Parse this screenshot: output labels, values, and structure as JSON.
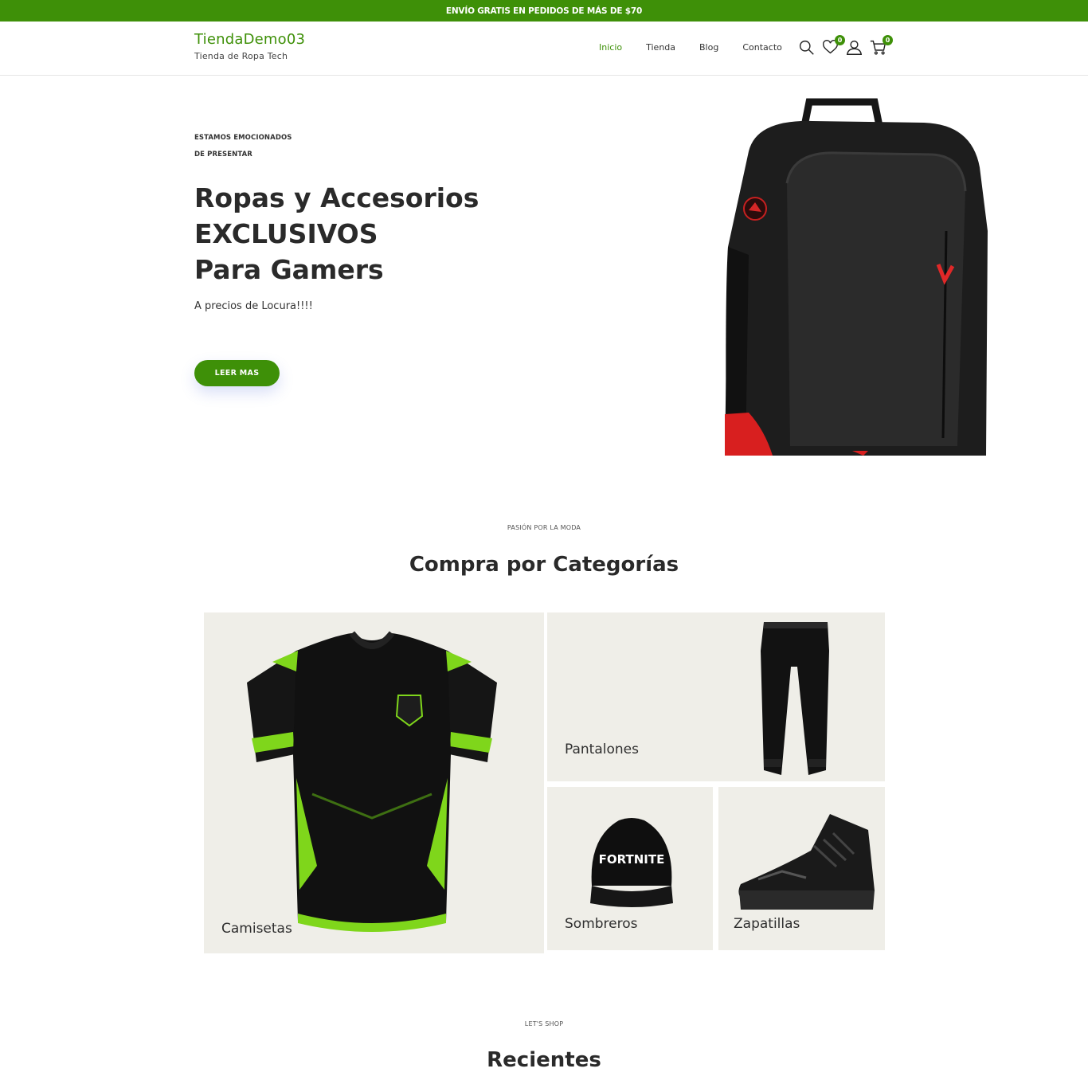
{
  "topbar": {
    "text": "ENVÍO GRATIS EN PEDIDOS DE MÁS DE $70"
  },
  "header": {
    "site_name": "TiendaDemo03",
    "tagline": "Tienda de Ropa Tech",
    "nav": [
      {
        "label": "Inicio",
        "active": true
      },
      {
        "label": "Tienda"
      },
      {
        "label": "Blog"
      },
      {
        "label": "Contacto"
      }
    ],
    "icons": [
      "search-icon",
      "heart-icon",
      "user-icon",
      "cart-icon"
    ],
    "wishlist_count": "0",
    "cart_count": "0"
  },
  "hero": {
    "eyebrow_line1": "ESTAMOS EMOCIONADOS",
    "eyebrow_line2": "DE PRESENTAR",
    "title_line1": "Ropas y Accesorios",
    "title_line2": "EXCLUSIVOS",
    "title_line3": "Para Gamers",
    "subtitle": "A precios de Locura!!!!",
    "button_label": "LEER MAS"
  },
  "categories_section": {
    "eyebrow": "PASIÓN POR LA MODA",
    "title": "Compra por Categorías",
    "items": [
      {
        "label": "Camisetas"
      },
      {
        "label": "Pantalones"
      },
      {
        "label": "Sombreros",
        "cap_text": "FORTNITE"
      },
      {
        "label": "Zapatillas"
      }
    ]
  },
  "recent_section": {
    "eyebrow": "LET'S SHOP",
    "title": "Recientes"
  },
  "colors": {
    "brand_green": "#3e9008",
    "tile_bg": "#efeee8"
  }
}
